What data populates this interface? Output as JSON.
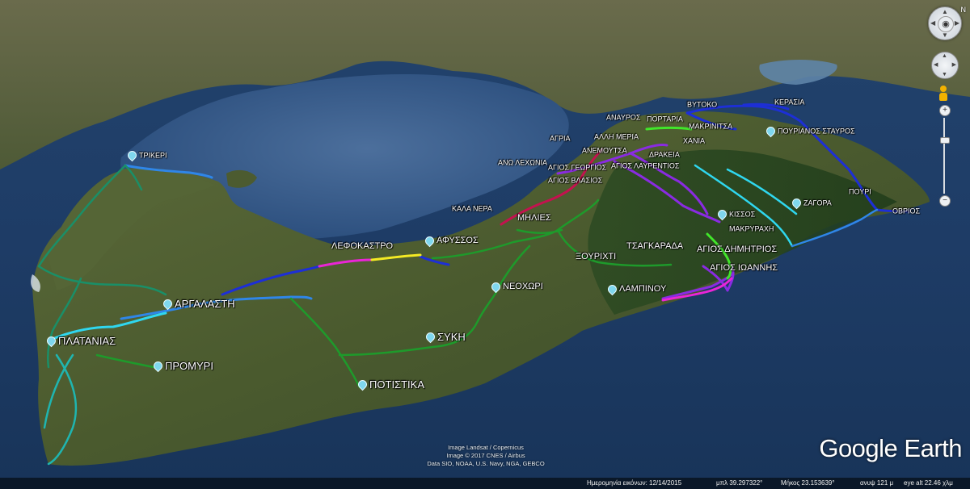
{
  "places": [
    {
      "id": "trikeri",
      "label": "ΤΡΙΚΕΡΙ",
      "size": "s"
    },
    {
      "id": "lefokastro",
      "label": "ΛΕΦΟΚΑΣΤΡΟ",
      "size": "m"
    },
    {
      "id": "afyssos",
      "label": "ΑΦΥΣΣΟΣ",
      "size": "m"
    },
    {
      "id": "kala_nera",
      "label": "ΚΑΛΑ ΝΕΡΑ",
      "size": "s"
    },
    {
      "id": "milies",
      "label": "ΜΗΛΙΕΣ",
      "size": "m"
    },
    {
      "id": "neochori",
      "label": "ΝΕΟΧΩΡΙ",
      "size": "m"
    },
    {
      "id": "argalasti",
      "label": "ΑΡΓΑΛΑΣΤΗ",
      "size": "l"
    },
    {
      "id": "platanias",
      "label": "ΠΛΑΤΑΝΙΑΣ",
      "size": "l"
    },
    {
      "id": "promyri",
      "label": "ΠΡΟΜΥΡΙ",
      "size": "l"
    },
    {
      "id": "syki",
      "label": "ΣΥΚΗ",
      "size": "l"
    },
    {
      "id": "potistika",
      "label": "ΠΟΤΙΣΤΙΚΑ",
      "size": "l"
    },
    {
      "id": "xourichti",
      "label": "ΞΟΥΡΙΧΤΙ",
      "size": "m"
    },
    {
      "id": "lampinou",
      "label": "ΛΑΜΠΙΝΟΥ",
      "size": "m"
    },
    {
      "id": "tsagkarada",
      "label": "ΤΣΑΓΚΑΡΑΔΑ",
      "size": "m"
    },
    {
      "id": "agios_dimitrios",
      "label": "ΑΓΙΟΣ ΔΗΜΗΤΡΙΟΣ",
      "size": "m"
    },
    {
      "id": "agios_ioannis",
      "label": "ΑΓΙΟΣ ΙΩΑΝΝΗΣ",
      "size": "m"
    },
    {
      "id": "kissos",
      "label": "ΚΙΣΣΟΣ",
      "size": "s"
    },
    {
      "id": "makryrachi",
      "label": "ΜΑΚΡΥΡΑΧΗ",
      "size": "s"
    },
    {
      "id": "zagora",
      "label": "ΖΑΓΟΡΑ",
      "size": "s"
    },
    {
      "id": "pouri",
      "label": "ΠΟΥΡΙ",
      "size": "s"
    },
    {
      "id": "ovrios",
      "label": "ΟΒΡΙΟΣ",
      "size": "s"
    },
    {
      "id": "ano_lechonia",
      "label": "ΑΝΩ ΛΕΧΩΝΙΑ",
      "size": "s"
    },
    {
      "id": "agios_georgios",
      "label": "ΑΓΙΟΣ ΓΕΩΡΓΙΟΣ",
      "size": "s"
    },
    {
      "id": "agios_lavrentios",
      "label": "ΑΓΙΟΣ ΛΑΥΡΕΝΤΙΟΣ",
      "size": "s"
    },
    {
      "id": "agios_vlasios",
      "label": "ΑΓΙΟΣ ΒΛΑΣΙΟΣ",
      "size": "s"
    },
    {
      "id": "agria",
      "label": "ΑΓΡΙΑ",
      "size": "s"
    },
    {
      "id": "anemoutsa",
      "label": "ΑΝΕΜΟΥΤΣΑ",
      "size": "s"
    },
    {
      "id": "drakeia",
      "label": "ΔΡΑΚΕΙΑ",
      "size": "s"
    },
    {
      "id": "chania",
      "label": "ΧΑΝΙΑ",
      "size": "s"
    },
    {
      "id": "alli_meria",
      "label": "ΑΛΛΗ ΜΕΡΙΑ",
      "size": "s"
    },
    {
      "id": "anavros",
      "label": "ΑΝΑΥΡΟΣ",
      "size": "s"
    },
    {
      "id": "portaria",
      "label": "ΠΟΡΤΑΡΙΑ",
      "size": "s"
    },
    {
      "id": "makrinitsa",
      "label": "ΜΑΚΡΙΝΙΤΣΑ",
      "size": "s"
    },
    {
      "id": "vyzitsa",
      "label": "ΒΥΤΟΚΟ",
      "size": "s"
    },
    {
      "id": "keramidi",
      "label": "ΚΕΡΑΣΙΑ",
      "size": "s"
    },
    {
      "id": "pourianos_stavros",
      "label": "ΠΟΥΡΙΑΝΟΣ ΣΤΑΥΡΟΣ",
      "size": "s"
    }
  ],
  "route_colors": {
    "darkblue": "#1d2fd6",
    "blue": "#2f86e8",
    "cyan": "#2fd7ef",
    "green": "#1e9a2b",
    "seagreen": "#1a8f68",
    "purple": "#8a2be2",
    "magenta": "#ea25d6",
    "yellow": "#f4ea24",
    "crimson": "#c4124f",
    "lime": "#41e62a",
    "teal": "#1fb5b0"
  },
  "attribution": {
    "line1": "Image Landsat / Copernicus",
    "line2": "Image © 2017 CNES / Airbus",
    "line3": "Data SIO, NOAA, U.S. Navy, NGA, GEBCO"
  },
  "logo": "Google Earth",
  "statusbar": {
    "date": "Ημερομηνία εικόνων: 12/14/2015",
    "lat": "μπλ  39.297322°",
    "lon": "Μήκος  23.153639°",
    "elev": "ανυψ  121 μ",
    "eye": "eye alt  22.46 χλμ"
  },
  "nav": {
    "north": "N",
    "zoom_in": "+",
    "zoom_out": "−"
  }
}
